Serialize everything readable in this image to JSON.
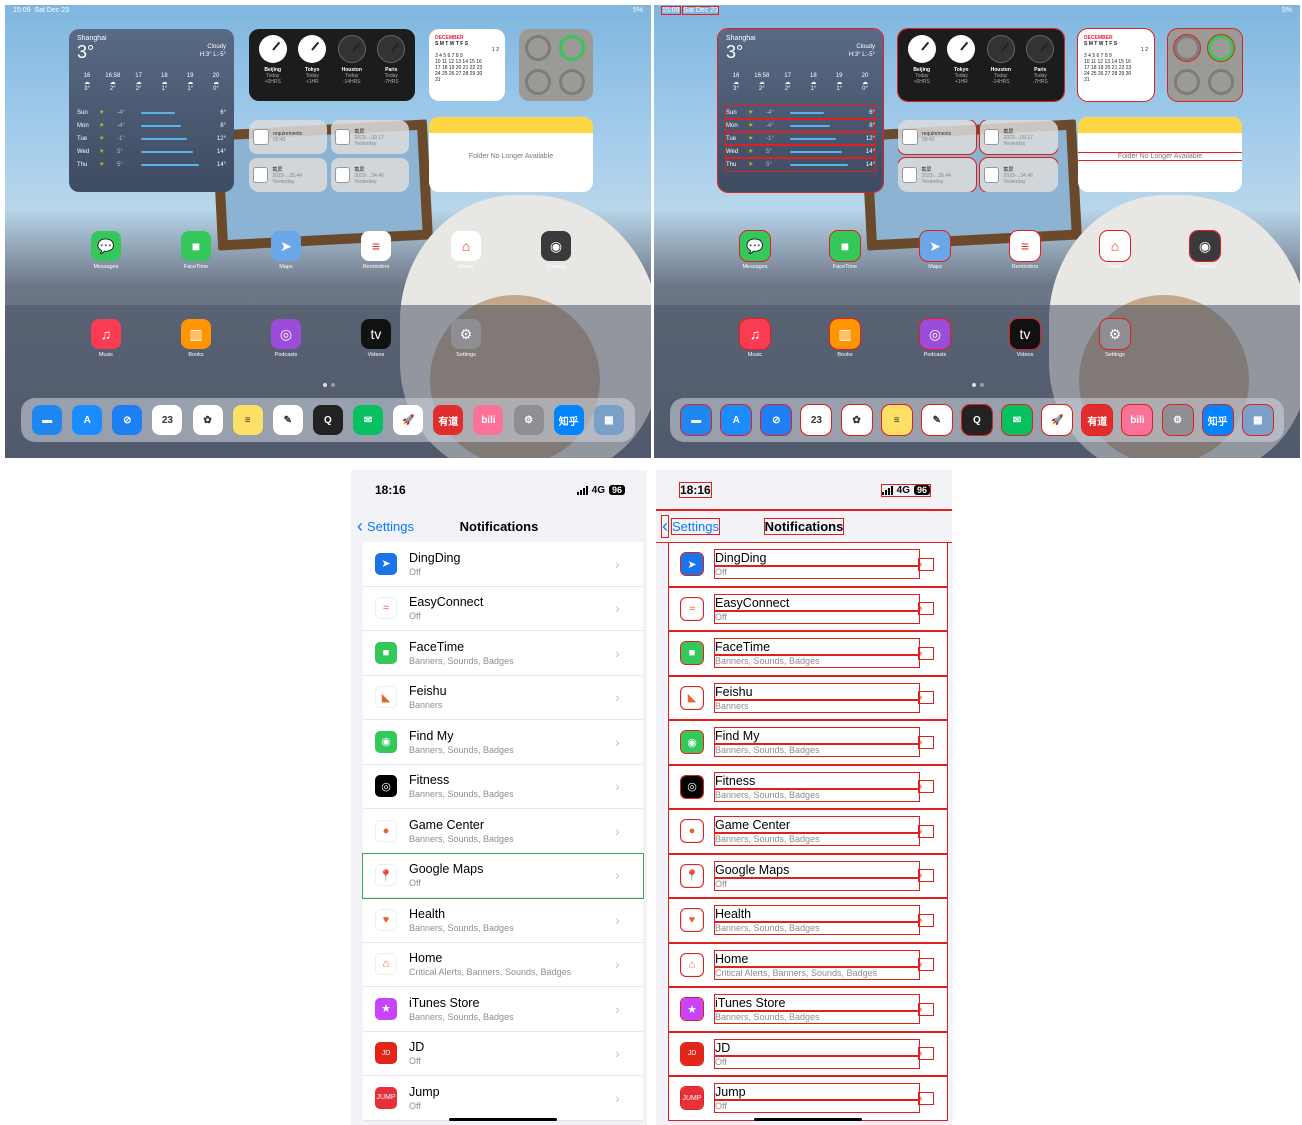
{
  "ipad": {
    "status_time": "15:09",
    "status_date": "Sat Dec 23",
    "status_battery": "5%",
    "weather": {
      "city": "Shanghai",
      "temp": "3°",
      "condition": "Cloudy",
      "hilo": "H:3° L:-5°",
      "hours": [
        {
          "t": "16",
          "v": "3°"
        },
        {
          "t": "16:58",
          "v": "2°"
        },
        {
          "t": "17",
          "v": "2°"
        },
        {
          "t": "18",
          "v": "1°"
        },
        {
          "t": "19",
          "v": "1°"
        },
        {
          "t": "20",
          "v": "0°"
        }
      ],
      "days": [
        {
          "d": "Sun",
          "lo": "-4°",
          "hi": "6°"
        },
        {
          "d": "Mon",
          "lo": "-4°",
          "hi": "8°"
        },
        {
          "d": "Tue",
          "lo": "-1°",
          "hi": "12°"
        },
        {
          "d": "Wed",
          "lo": "5°",
          "hi": "14°"
        },
        {
          "d": "Thu",
          "lo": "5°",
          "hi": "14°"
        }
      ]
    },
    "clocks": [
      {
        "city": "Beijing",
        "day": "Today",
        "off": "+0HRS"
      },
      {
        "city": "Tokyo",
        "day": "Today",
        "off": "+1HR"
      },
      {
        "city": "Houston",
        "day": "Today",
        "off": "-14HRS"
      },
      {
        "city": "Paris",
        "day": "Today",
        "off": "-7HRS"
      }
    ],
    "calendar_month": "DECEMBER",
    "calendar_weekdays": "S M T W T F S",
    "calendar_rows": [
      "1 2",
      "3 4 5 6 7 8 9",
      "10 11 12 13 14 15 16",
      "17 18 19 20 21 22 23",
      "24 25 26 27 28 29 30",
      "31"
    ],
    "files": [
      {
        "name": "requirements",
        "meta": "09:42"
      },
      {
        "name": "截屏",
        "meta": "2023-...09.17 Yesterday"
      },
      {
        "name": "截屏",
        "meta": "2023-...35.44 Yesterday"
      },
      {
        "name": "截屏",
        "meta": "2023-...34.46 Yesterday"
      }
    ],
    "notes_message": "Folder No Longer Available",
    "apps_row1": [
      {
        "label": "Messages",
        "color": "#34c759",
        "glyph": "💬"
      },
      {
        "label": "FaceTime",
        "color": "#34c759",
        "glyph": "■"
      },
      {
        "label": "Maps",
        "color": "#6aa7e8",
        "glyph": "➤"
      },
      {
        "label": "Reminders",
        "color": "#ffffff",
        "glyph": "≡"
      },
      {
        "label": "Home",
        "color": "#ffffff",
        "glyph": "⌂"
      },
      {
        "label": "Camera",
        "color": "#3a3a3c",
        "glyph": "◉"
      }
    ],
    "apps_row2": [
      {
        "label": "Music",
        "color": "#fa3c52",
        "glyph": "♫"
      },
      {
        "label": "Books",
        "color": "#ff9500",
        "glyph": "▥"
      },
      {
        "label": "Podcasts",
        "color": "#9b4dd9",
        "glyph": "◎"
      },
      {
        "label": "Videos",
        "color": "#111111",
        "glyph": "tv"
      },
      {
        "label": "Settings",
        "color": "#8e8e93",
        "glyph": "⚙"
      }
    ],
    "dock": [
      {
        "name": "files",
        "color": "#1e88f0",
        "glyph": "▬"
      },
      {
        "name": "app-store",
        "color": "#1a8cff",
        "glyph": "A"
      },
      {
        "name": "safari",
        "color": "#1d7ff2",
        "glyph": "⊘"
      },
      {
        "name": "calendar",
        "color": "#ffffff",
        "glyph": "23"
      },
      {
        "name": "photos",
        "color": "#ffffff",
        "glyph": "✿"
      },
      {
        "name": "notes",
        "color": "#ffe066",
        "glyph": "≡"
      },
      {
        "name": "freeform",
        "color": "#ffffff",
        "glyph": "✎"
      },
      {
        "name": "qq",
        "color": "#222222",
        "glyph": "Q"
      },
      {
        "name": "wechat",
        "color": "#07c160",
        "glyph": "✉"
      },
      {
        "name": "testflight",
        "color": "#ffffff",
        "glyph": "🚀"
      },
      {
        "name": "youdao",
        "color": "#e02d2d",
        "glyph": "有道"
      },
      {
        "name": "bilibili",
        "color": "#fb7299",
        "glyph": "bili"
      },
      {
        "name": "settings",
        "color": "#8e8e93",
        "glyph": "⚙"
      },
      {
        "name": "zhihu",
        "color": "#0084ff",
        "glyph": "知乎"
      },
      {
        "name": "app-library",
        "color": "#7aa0c8",
        "glyph": "▦"
      }
    ]
  },
  "phone": {
    "time": "18:16",
    "network": "4G",
    "battery": "96",
    "back_label": "Settings",
    "title": "Notifications",
    "apps": [
      {
        "name": "DingDing",
        "sub": "Off",
        "color": "#1a73e8",
        "glyph": "➤"
      },
      {
        "name": "EasyConnect",
        "sub": "Off",
        "color": "#ffffff",
        "glyph": "≈"
      },
      {
        "name": "FaceTime",
        "sub": "Banners, Sounds, Badges",
        "color": "#34c759",
        "glyph": "■"
      },
      {
        "name": "Feishu",
        "sub": "Banners",
        "color": "#ffffff",
        "glyph": "◣"
      },
      {
        "name": "Find My",
        "sub": "Banners, Sounds, Badges",
        "color": "#34c759",
        "glyph": "◉"
      },
      {
        "name": "Fitness",
        "sub": "Banners, Sounds, Badges",
        "color": "#000000",
        "glyph": "◎"
      },
      {
        "name": "Game Center",
        "sub": "Banners, Sounds, Badges",
        "color": "#ffffff",
        "glyph": "●"
      },
      {
        "name": "Google Maps",
        "sub": "Off",
        "color": "#ffffff",
        "glyph": "📍"
      },
      {
        "name": "Health",
        "sub": "Banners, Sounds, Badges",
        "color": "#ffffff",
        "glyph": "♥"
      },
      {
        "name": "Home",
        "sub": "Critical Alerts, Banners, Sounds, Badges",
        "color": "#ffffff",
        "glyph": "⌂"
      },
      {
        "name": "iTunes Store",
        "sub": "Banners, Sounds, Badges",
        "color": "#c644fc",
        "glyph": "★"
      },
      {
        "name": "JD",
        "sub": "Off",
        "color": "#e1251b",
        "glyph": "JD"
      },
      {
        "name": "Jump",
        "sub": "Off",
        "color": "#e8303a",
        "glyph": "JUMP"
      }
    ]
  }
}
